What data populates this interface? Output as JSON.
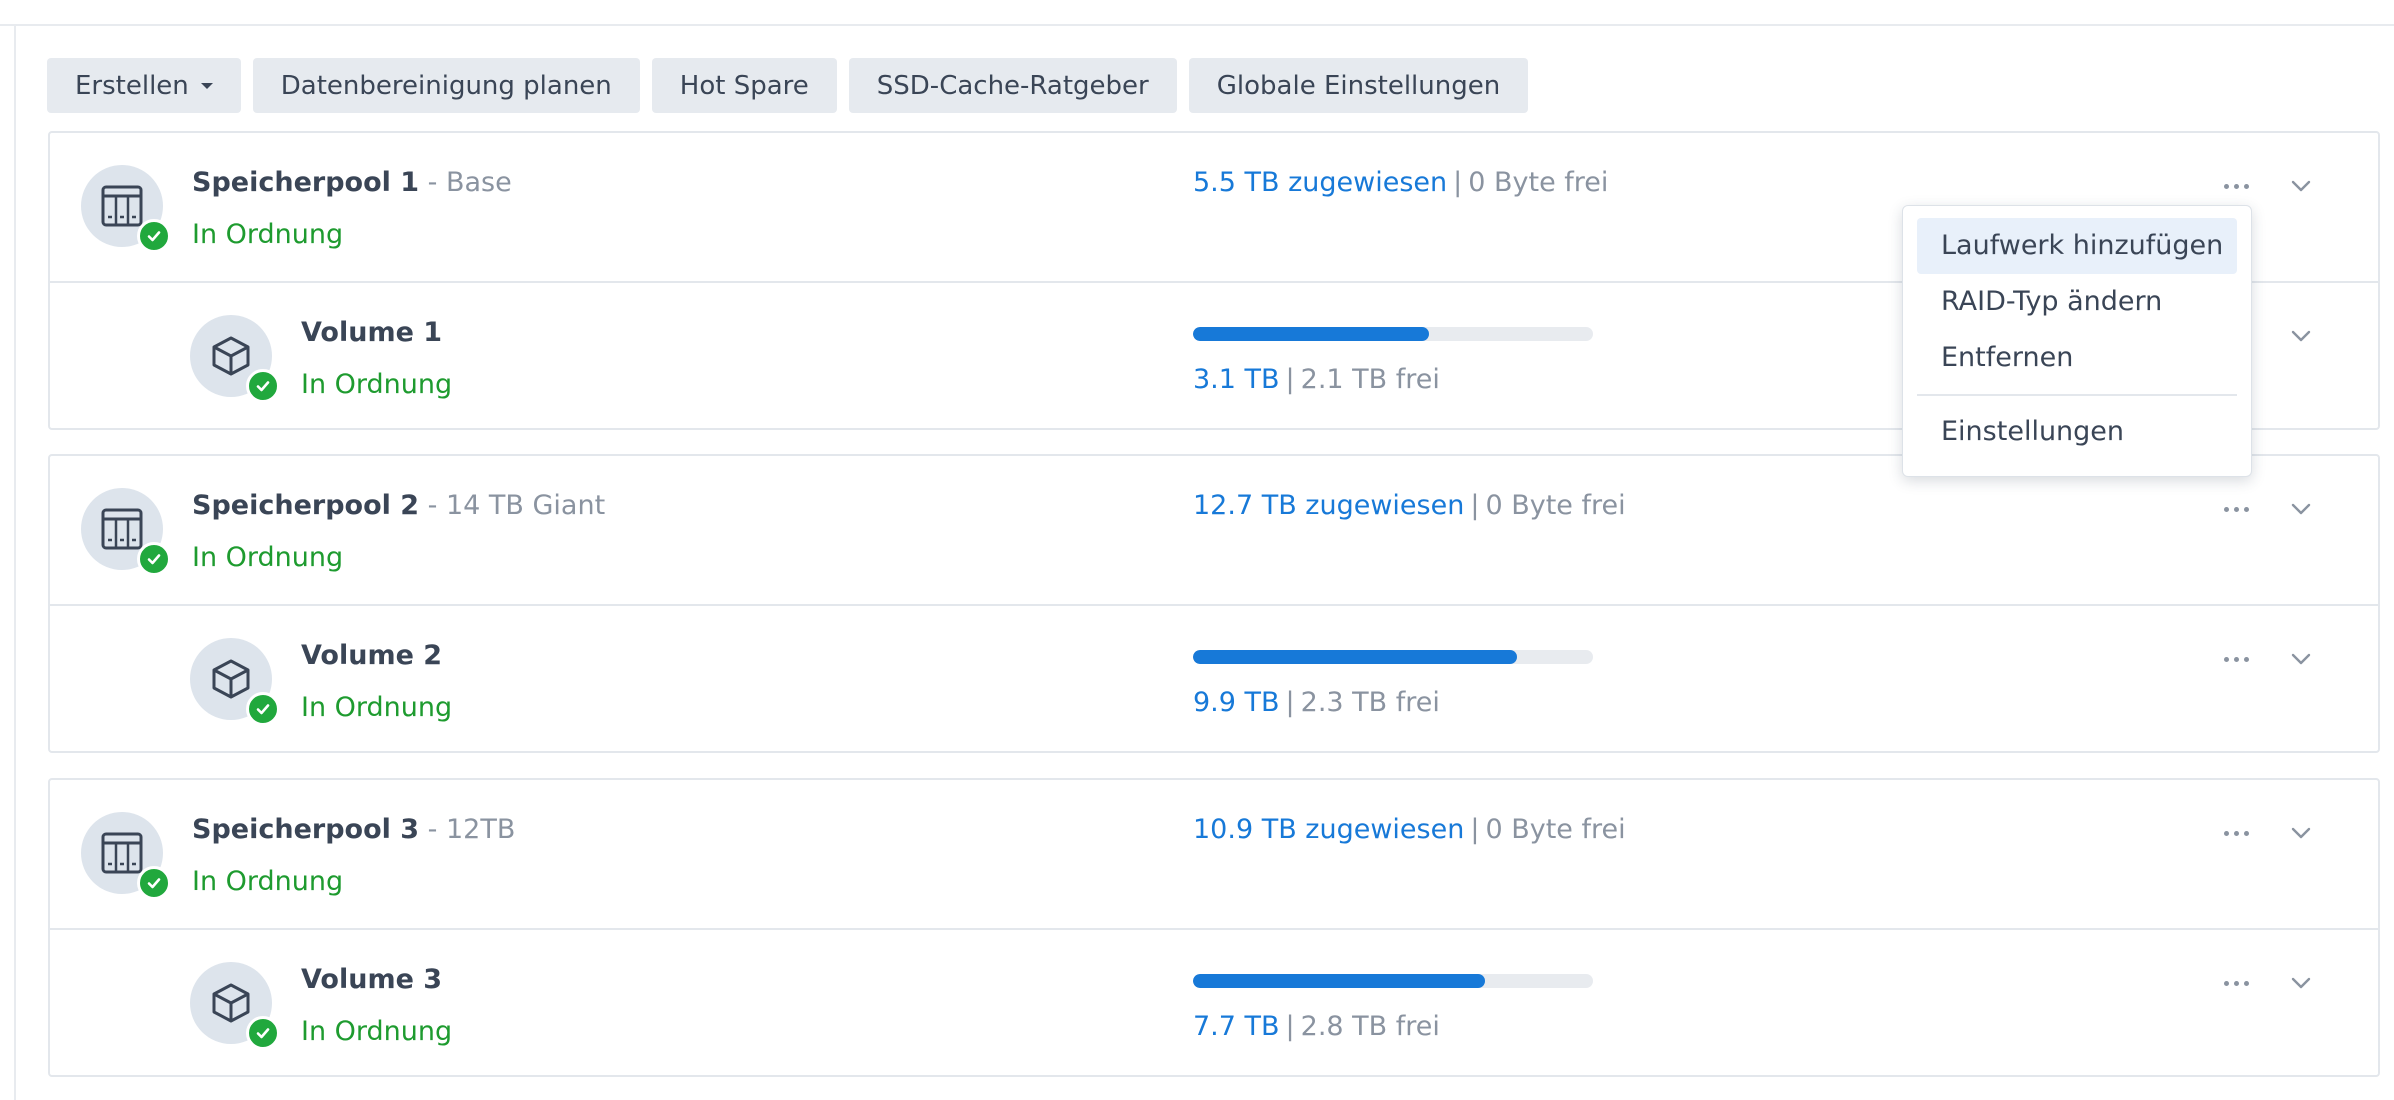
{
  "toolbar": {
    "create": "Erstellen",
    "schedule": "Datenbereinigung planen",
    "hotspare": "Hot Spare",
    "ssd": "SSD-Cache-Ratgeber",
    "global": "Globale Einstellungen"
  },
  "pools": [
    {
      "name": "Speicherpool 1",
      "subtitle": " - Base",
      "status": "In Ordnung",
      "allocated": "5.5 TB zugewiesen",
      "separator": "|",
      "free": "0 Byte frei",
      "volume": {
        "name": "Volume 1",
        "status": "In Ordnung",
        "used": "3.1 TB",
        "separator": "|",
        "free": "2.1 TB frei",
        "usage_fraction": 0.59
      }
    },
    {
      "name": "Speicherpool 2",
      "subtitle": " - 14 TB Giant",
      "status": "In Ordnung",
      "allocated": "12.7 TB zugewiesen",
      "separator": "|",
      "free": "0 Byte frei",
      "volume": {
        "name": "Volume 2",
        "status": "In Ordnung",
        "used": "9.9 TB",
        "separator": "|",
        "free": "2.3 TB frei",
        "usage_fraction": 0.81
      }
    },
    {
      "name": "Speicherpool 3",
      "subtitle": " - 12TB",
      "status": "In Ordnung",
      "allocated": "10.9 TB zugewiesen",
      "separator": "|",
      "free": "0 Byte frei",
      "volume": {
        "name": "Volume 3",
        "status": "In Ordnung",
        "used": "7.7 TB",
        "separator": "|",
        "free": "2.8 TB frei",
        "usage_fraction": 0.73
      }
    }
  ],
  "menu": {
    "add_drive": "Laufwerk hinzufügen",
    "change_raid": "RAID-Typ ändern",
    "remove": "Entfernen",
    "settings": "Einstellungen"
  },
  "colors": {
    "accent": "#1779d8",
    "ok": "#1e9b2f",
    "badge": "#21a83d"
  },
  "icons": {
    "pool": "storage-pool-icon",
    "volume": "volume-cube-icon",
    "status": "check-circle-icon",
    "more": "more-dots-icon",
    "expand": "chevron-down-icon"
  }
}
